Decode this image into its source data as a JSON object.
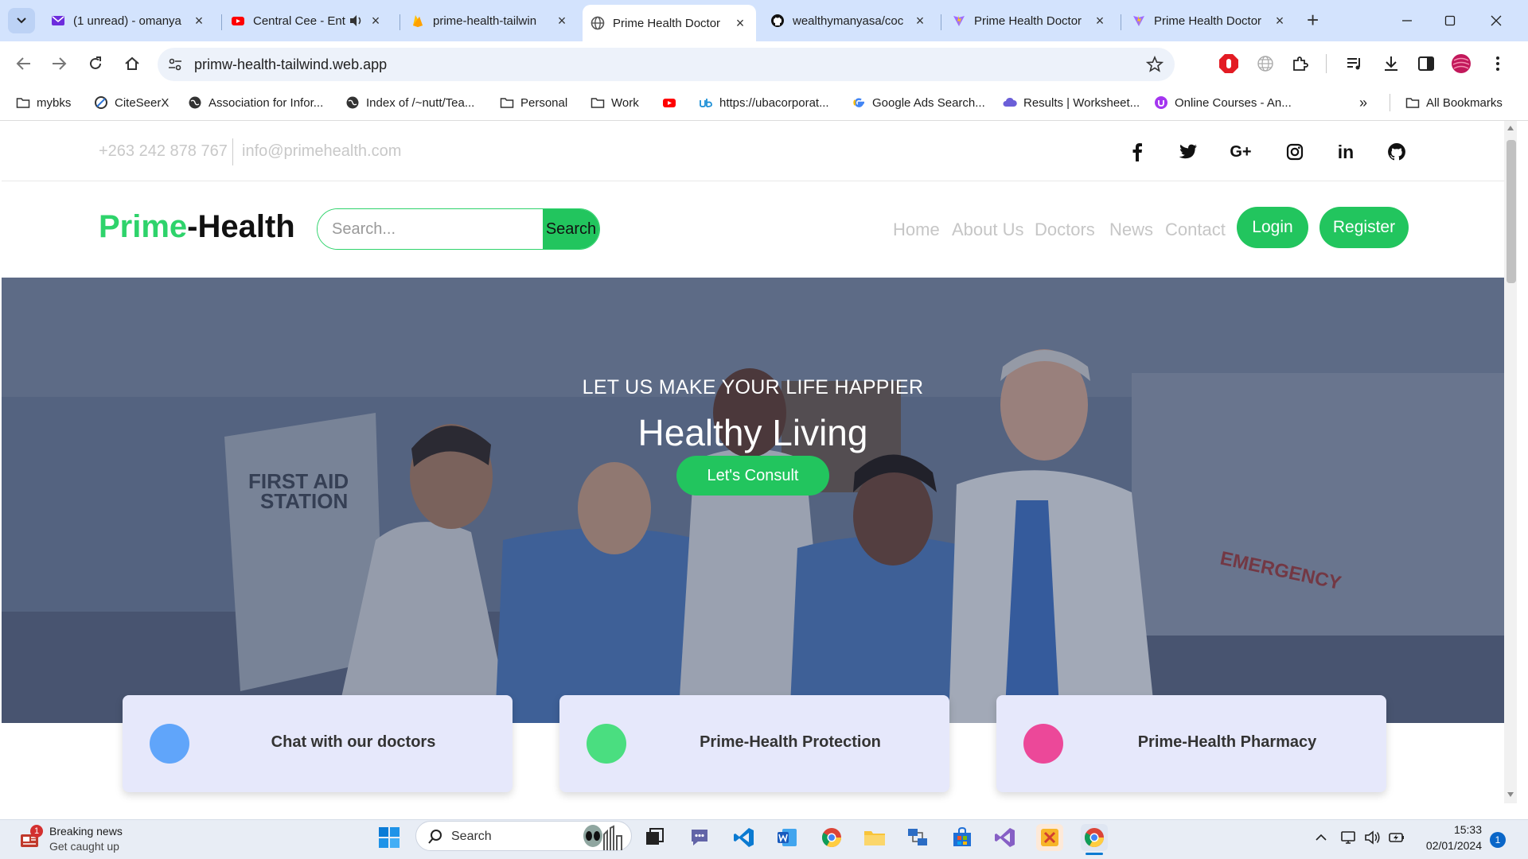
{
  "browser": {
    "tabs": [
      {
        "title": "(1 unread) - omanya",
        "icon": "yahoo-mail-icon",
        "color": "#6d2ddd"
      },
      {
        "title": "Central Cee - Ent",
        "icon": "youtube-icon",
        "color": "#ff0000"
      },
      {
        "title": "prime-health-tailwin",
        "icon": "firebase-icon",
        "color": "#ffc107"
      },
      {
        "title": "Prime Health Doctor",
        "icon": "globe-icon",
        "color": "#555555",
        "active": true
      },
      {
        "title": "wealthymanyasa/coc",
        "icon": "github-icon",
        "color": "#111111"
      },
      {
        "title": "Prime Health Doctor",
        "icon": "vite-icon",
        "color": "#9e6bff"
      },
      {
        "title": "Prime Health Doctor",
        "icon": "vite-icon",
        "color": "#9e6bff"
      }
    ],
    "url": "primw-health-tailwind.web.app",
    "bookmarks": [
      {
        "label": "mybks",
        "icon": "folder-icon"
      },
      {
        "label": "CiteSeerX",
        "icon": "citeseerx-icon"
      },
      {
        "label": "Association for Infor...",
        "icon": "globe-icon"
      },
      {
        "label": "Index of /~nutt/Tea...",
        "icon": "globe-icon"
      },
      {
        "label": "Personal",
        "icon": "folder-icon"
      },
      {
        "label": "Work",
        "icon": "folder-icon"
      },
      {
        "label": "",
        "icon": "youtube-icon"
      },
      {
        "label": "https://ubacorporat...",
        "icon": "uba-icon"
      },
      {
        "label": "Google Ads Search...",
        "icon": "google-icon"
      },
      {
        "label": "Results | Worksheet...",
        "icon": "cloud-icon"
      },
      {
        "label": "Online Courses - An...",
        "icon": "udemy-icon"
      }
    ],
    "all_bookmarks": "All Bookmarks",
    "overflow": "»"
  },
  "site": {
    "phone": "+263 242 878 767",
    "email": "info@primehealth.com",
    "social": [
      "facebook-icon",
      "twitter-icon",
      "google-plus-icon",
      "instagram-icon",
      "linkedin-icon",
      "github-icon"
    ],
    "social_text": {
      "google_plus": "G+",
      "linkedin": "in"
    },
    "logo_a": "Prime",
    "logo_b": "-Health",
    "search_placeholder": "Search...",
    "search_button": "Search",
    "nav": [
      "Home",
      "About Us",
      "Doctors",
      "News",
      "Contact"
    ],
    "login": "Login",
    "register": "Register",
    "hero": {
      "eyebrow": "LET US MAKE YOUR LIFE HAPPIER",
      "title": "Healthy Living",
      "cta": "Let's Consult",
      "photo_text": [
        "FIRST AID",
        "STATION",
        "EMERGENCY"
      ]
    },
    "cards": [
      {
        "title": "Chat with our doctors",
        "color": "#60a5fa"
      },
      {
        "title": "Prime-Health Protection",
        "color": "#4ade80"
      },
      {
        "title": "Prime-Health Pharmacy",
        "color": "#ec4899"
      }
    ],
    "brand_green": "#22c55e"
  },
  "taskbar": {
    "news_title": "Breaking news",
    "news_sub": "Get caught up",
    "news_badge": "1",
    "search_label": "Search",
    "time": "15:33",
    "date": "02/01/2024",
    "notification_count": "1"
  }
}
